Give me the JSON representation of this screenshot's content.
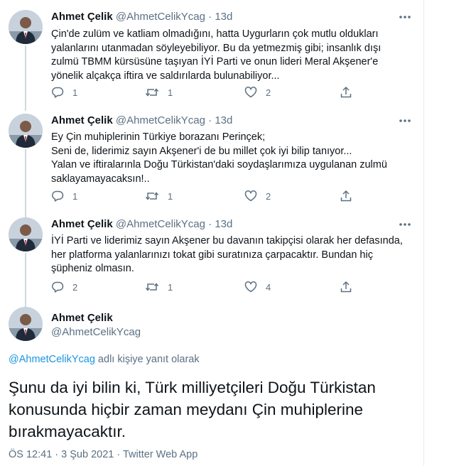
{
  "thread": [
    {
      "name": "Ahmet Çelik",
      "handle": "@AhmetCelikYcag",
      "sep": "·",
      "time": "13d",
      "text": "Çin'de zulüm ve katliam olmadığını, hatta Uygurların çok mutlu oldukları\nyalanlarını utanmadan söyleyebiliyor. Bu da yetmezmiş gibi; insanlık dışı\nzulmü TBMM kürsüsüne taşıyan İYİ Parti ve onun lideri Meral Akşener'e\nyönelik alçakça iftira ve saldırılarda bulunabiliyor...",
      "replies": "1",
      "retweets": "1",
      "likes": "2"
    },
    {
      "name": "Ahmet Çelik",
      "handle": "@AhmetCelikYcag",
      "sep": "·",
      "time": "13d",
      "text": "Ey Çin muhiplerinin Türkiye borazanı Perinçek;\nSeni de, liderimiz sayın Akşener'i de bu millet çok iyi bilip tanıyor...\nYalan ve iftiralarınla Doğu Türkistan'daki soydaşlarımıza uygulanan zulmü\nsaklayamayacaksın!..",
      "replies": "1",
      "retweets": "1",
      "likes": "2"
    },
    {
      "name": "Ahmet Çelik",
      "handle": "@AhmetCelikYcag",
      "sep": "·",
      "time": "13d",
      "text": "İYİ Parti ve liderimiz sayın Akşener bu davanın takipçisi olarak her defasında,\nher platforma yalanlarınızı tokat gibi suratınıza çarpacaktır. Bundan hiç\nşüpheniz olmasın.",
      "replies": "2",
      "retweets": "1",
      "likes": "4"
    }
  ],
  "main_tweet": {
    "name": "Ahmet Çelik",
    "handle": "@AhmetCelikYcag",
    "reply_mention": "@AhmetCelikYcag",
    "reply_suffix": " adlı kişiye yanıt olarak",
    "text": "Şunu da iyi bilin ki, Türk milliyetçileri Doğu Türkistan\nkonusunda hiçbir zaman meydanı Çin muhiplerine\nbırakmayacaktır.",
    "meta": "ÖS 12:41 · 3 Şub 2021 · Twitter Web App"
  },
  "icons": {
    "reply": "reply-icon",
    "retweet": "retweet-icon",
    "like": "heart-icon",
    "share": "share-icon",
    "more": "more-icon"
  },
  "colors": {
    "text": "#0f1419",
    "secondary": "#5b7083",
    "link": "#1b95e0",
    "border": "#e6ecf0",
    "thread_line": "#cfd9de"
  }
}
